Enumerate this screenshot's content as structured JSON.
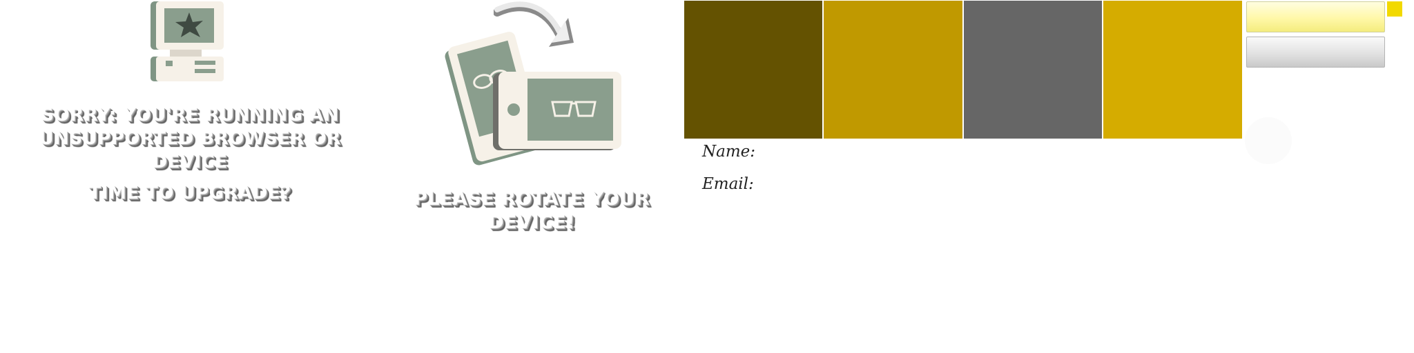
{
  "unsupported": {
    "line1": "Sorry: You're running an",
    "line2": "unsupported browser or device",
    "subline": "Time to upgrade?"
  },
  "rotate": {
    "message": "Please rotate your device!"
  },
  "icons": {
    "computer": "retro-computer-icon",
    "rotate_arrow": "rotate-arrow-icon",
    "portrait_device": "portrait-tablet-icon",
    "landscape_device": "landscape-tablet-icon"
  },
  "palette": {
    "swatches": [
      "#645201",
      "#c09900",
      "#666666",
      "#d5ac00"
    ],
    "icon_green": "#8a9e8d",
    "icon_cream": "#f6f1e8",
    "accent_yellow": "#f2d900"
  },
  "form": {
    "name_label": "Name:",
    "email_label": "Email:"
  }
}
